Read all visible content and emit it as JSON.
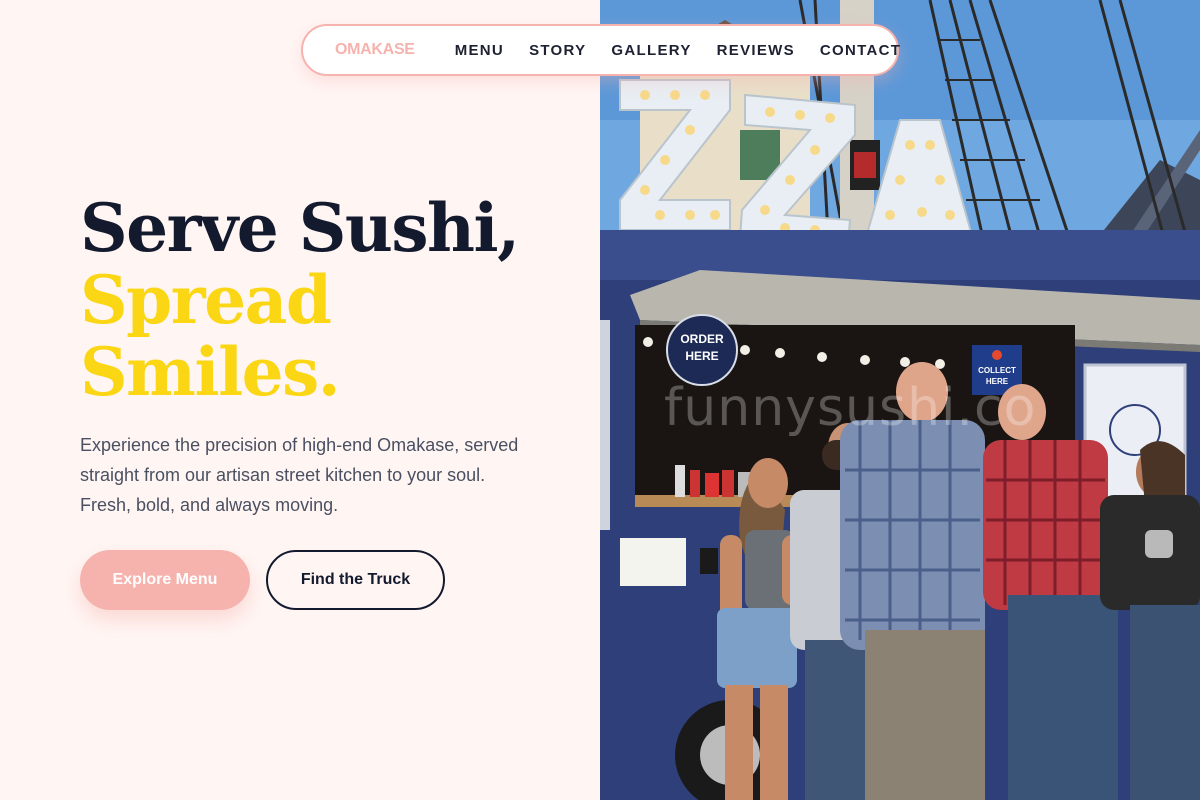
{
  "nav": {
    "logo": "OMAKASE",
    "links": [
      "MENU",
      "STORY",
      "GALLERY",
      "REVIEWS",
      "CONTACT"
    ]
  },
  "hero": {
    "headline_line1": "Serve Sushi,",
    "headline_line2": "Spread",
    "headline_line3": "Smiles.",
    "lede": "Experience the precision of high-end Omakase, served straight from our artisan street kitchen to your soul. Fresh, bold, and always moving.",
    "primary_button": "Explore Menu",
    "secondary_button": "Find the Truck"
  },
  "photo": {
    "watermark": "funnysushi.co",
    "order_sign_line1": "ORDER",
    "order_sign_line2": "HERE",
    "collect_sign_line1": "COLLECT",
    "collect_sign_line2": "HERE"
  },
  "colors": {
    "accent_pink": "#f6b3ae",
    "accent_yellow": "#fbd615",
    "navy": "#141a2e",
    "background": "#fff6f4"
  }
}
